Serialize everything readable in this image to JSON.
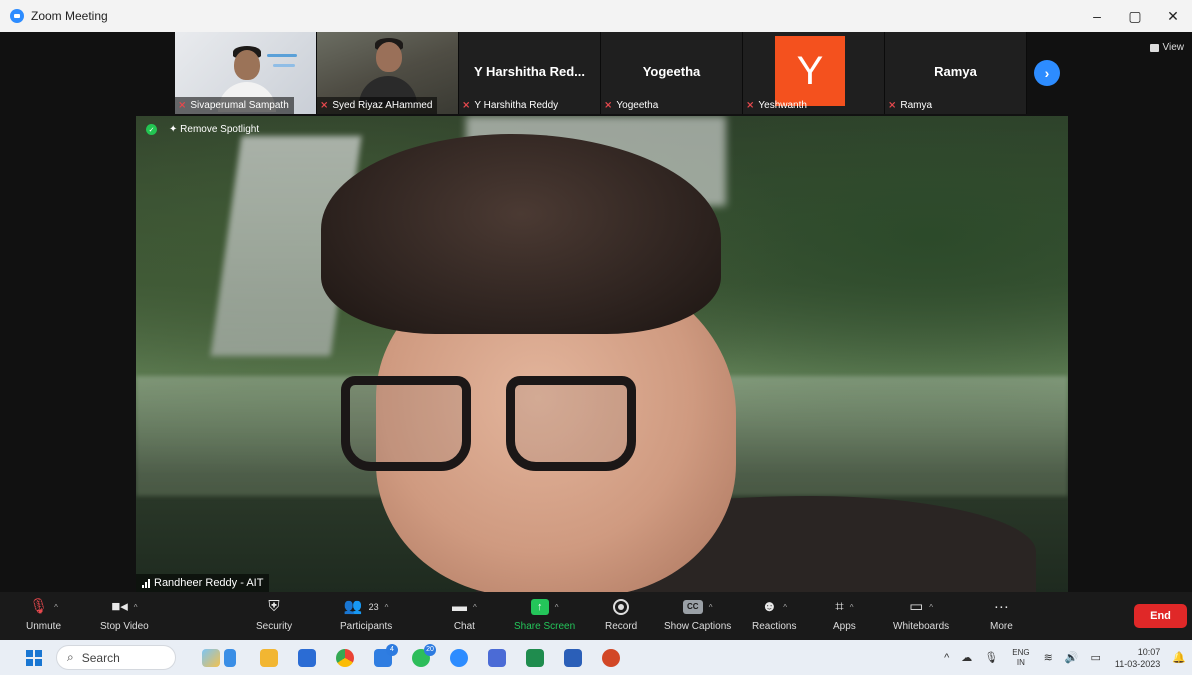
{
  "window": {
    "title": "Zoom Meeting",
    "controls": [
      "–",
      "▢",
      "✕"
    ]
  },
  "gallery": {
    "tiles": [
      {
        "name": "Sivaperumal Sampath",
        "type": "video"
      },
      {
        "name": "Syed Riyaz AHammed",
        "type": "video"
      },
      {
        "name": "Y Harshitha Reddy",
        "display_name": "Y Harshitha Red...",
        "type": "name"
      },
      {
        "name": "Yogeetha",
        "display_name": "Yogeetha",
        "type": "name"
      },
      {
        "name": "Yeshwanth",
        "avatar_letter": "Y",
        "avatar_color": "#f4511e",
        "type": "avatar"
      },
      {
        "name": "Ramya",
        "display_name": "Ramya",
        "type": "name"
      }
    ],
    "next_icon": "chevron-right-icon",
    "view_label": "View"
  },
  "spotlight": {
    "remove_label": "Remove Spotlight",
    "speaker_name": "Randheer Reddy - AIT"
  },
  "toolbar": {
    "unmute": "Unmute",
    "stop_video": "Stop Video",
    "security": "Security",
    "participants": "Participants",
    "participants_count": "23",
    "chat": "Chat",
    "share_screen": "Share Screen",
    "record": "Record",
    "show_captions": "Show Captions",
    "captions_icon": "CC",
    "reactions": "Reactions",
    "apps": "Apps",
    "whiteboards": "Whiteboards",
    "more": "More",
    "end": "End",
    "accent_color": "#24c55a",
    "end_color": "#e02828"
  },
  "taskbar": {
    "search_placeholder": "Search",
    "badges": {
      "todo": "4",
      "whatsapp": "20"
    },
    "lang_line1": "ENG",
    "lang_line2": "IN",
    "time": "10:07",
    "date": "11-03-2023"
  }
}
